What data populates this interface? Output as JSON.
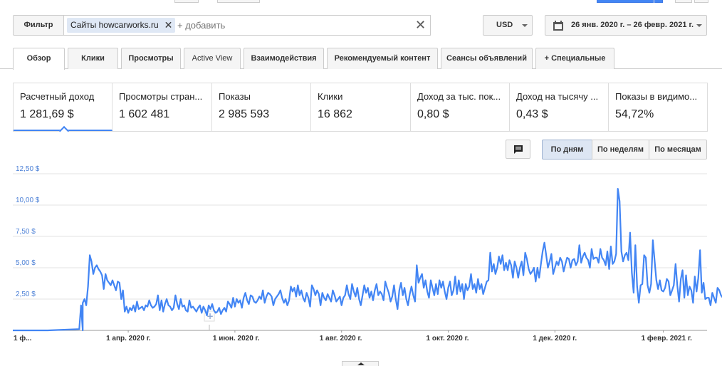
{
  "filter": {
    "label": "Фильтр",
    "chip": "Сайты howcarworks.ru",
    "add_placeholder": "+ добавить"
  },
  "currency": "USD",
  "date_range": "26 янв. 2020 г. – 26 февр. 2021 г.",
  "tabs": [
    {
      "label": "Обзор"
    },
    {
      "label": "Клики"
    },
    {
      "label": "Просмотры"
    },
    {
      "label": "Active View"
    },
    {
      "label": "Взаимодействия"
    },
    {
      "label": "Рекомендуемый контент"
    },
    {
      "label": "Сеансы объявлений"
    },
    {
      "label": "+  Специальные"
    }
  ],
  "metrics": [
    {
      "label": "Расчетный доход",
      "value": "1 281,69 $"
    },
    {
      "label": "Просмотры стран...",
      "value": "1 602 481"
    },
    {
      "label": "Показы",
      "value": "2 985 593"
    },
    {
      "label": "Клики",
      "value": "16 862"
    },
    {
      "label": "Доход за тыс. пок...",
      "value": "0,80 $"
    },
    {
      "label": "Доход на тысячу ...",
      "value": "0,43 $"
    },
    {
      "label": "Показы в видимо...",
      "value": "54,72%"
    }
  ],
  "granularity": [
    {
      "label": "По дням"
    },
    {
      "label": "По неделям"
    },
    {
      "label": "По месяцам"
    }
  ],
  "chart_data": {
    "type": "line",
    "series": [
      {
        "color": "#4285f4"
      }
    ],
    "y_ticks": [
      "12,50 $",
      "10,00 $",
      "7,50 $",
      "5,00 $",
      "2,50 $"
    ],
    "y_tick_values": [
      12.5,
      10,
      7.5,
      5,
      2.5
    ],
    "ylim": [
      0,
      12.5
    ],
    "x_ticks": [
      "1 ф...",
      "1 апр. 2020 г.",
      "1 июн. 2020 г.",
      "1 авг. 2020 г.",
      "1 окт. 2020 г.",
      "1 дек. 2020 г.",
      "1 февр. 2021 г."
    ],
    "x_tick_days": [
      6,
      66,
      127,
      188,
      249,
      310,
      372
    ],
    "x_range_days": [
      0,
      397
    ],
    "grid": true,
    "points": [
      [
        0,
        0
      ],
      [
        20,
        0
      ],
      [
        40,
        0
      ],
      [
        38,
        0.1
      ],
      [
        39,
        2.0
      ],
      [
        40,
        2.2
      ],
      [
        41,
        2.5
      ],
      [
        42,
        2.0
      ],
      [
        43,
        3.5
      ],
      [
        44,
        6.0
      ],
      [
        45,
        5.5
      ],
      [
        46,
        4.5
      ],
      [
        47,
        5.0
      ],
      [
        48,
        5.2
      ],
      [
        49,
        4.9
      ],
      [
        50,
        4.7
      ],
      [
        51,
        4.4
      ],
      [
        52,
        3.3
      ],
      [
        53,
        4.5
      ],
      [
        54,
        4.0
      ],
      [
        55,
        3.8
      ],
      [
        56,
        3.6
      ],
      [
        57,
        4.0
      ],
      [
        58,
        3.6
      ],
      [
        59,
        3.2
      ],
      [
        60,
        3.9
      ],
      [
        61,
        3.8
      ],
      [
        62,
        2.5
      ],
      [
        63,
        3.2
      ],
      [
        64,
        1.5
      ],
      [
        65,
        1.9
      ],
      [
        66,
        1.4
      ],
      [
        67,
        1.8
      ],
      [
        68,
        1.6
      ],
      [
        69,
        2.0
      ],
      [
        70,
        1.5
      ],
      [
        71,
        2.3
      ],
      [
        72,
        1.7
      ],
      [
        73,
        1.8
      ],
      [
        74,
        1.9
      ],
      [
        75,
        1.6
      ],
      [
        76,
        2.0
      ],
      [
        77,
        1.9
      ],
      [
        78,
        2.4
      ],
      [
        79,
        2.0
      ],
      [
        80,
        1.8
      ],
      [
        81,
        1.9
      ],
      [
        82,
        2.1
      ],
      [
        83,
        2.8
      ],
      [
        84,
        1.6
      ],
      [
        85,
        2.4
      ],
      [
        86,
        1.5
      ],
      [
        87,
        2.1
      ],
      [
        88,
        2.5
      ],
      [
        89,
        2.0
      ],
      [
        90,
        1.9
      ],
      [
        91,
        1.6
      ],
      [
        92,
        1.8
      ],
      [
        93,
        2.8
      ],
      [
        94,
        2.1
      ],
      [
        95,
        1.7
      ],
      [
        96,
        2.5
      ],
      [
        97,
        1.9
      ],
      [
        98,
        2.0
      ],
      [
        99,
        1.6
      ],
      [
        100,
        1.5
      ],
      [
        101,
        2.4
      ],
      [
        102,
        1.8
      ],
      [
        103,
        1.9
      ],
      [
        104,
        1.7
      ],
      [
        105,
        1.5
      ],
      [
        106,
        1.8
      ],
      [
        107,
        2.0
      ],
      [
        108,
        1.4
      ],
      [
        109,
        1.9
      ],
      [
        110,
        1.6
      ],
      [
        111,
        1.2
      ],
      [
        112,
        2.0
      ],
      [
        113,
        1.7
      ],
      [
        114,
        2.1
      ],
      [
        115,
        1.6
      ],
      [
        116,
        1.4
      ],
      [
        117,
        1.5
      ],
      [
        118,
        1.8
      ],
      [
        119,
        1.3
      ],
      [
        120,
        1.6
      ],
      [
        121,
        1.8
      ],
      [
        122,
        1.5
      ],
      [
        123,
        2.3
      ],
      [
        124,
        2.1
      ],
      [
        125,
        1.8
      ],
      [
        126,
        2.6
      ],
      [
        127,
        1.9
      ],
      [
        128,
        2.5
      ],
      [
        129,
        2.2
      ],
      [
        130,
        2.4
      ],
      [
        131,
        1.8
      ],
      [
        132,
        2.6
      ],
      [
        133,
        3.0
      ],
      [
        134,
        2.4
      ],
      [
        135,
        2.1
      ],
      [
        136,
        2.8
      ],
      [
        137,
        2.7
      ],
      [
        138,
        2.3
      ],
      [
        139,
        2.2
      ],
      [
        140,
        2.4
      ],
      [
        141,
        2.7
      ],
      [
        142,
        2.5
      ],
      [
        143,
        3.2
      ],
      [
        144,
        2.2
      ],
      [
        145,
        2.7
      ],
      [
        146,
        3.0
      ],
      [
        147,
        2.9
      ],
      [
        148,
        2.7
      ],
      [
        149,
        2.0
      ],
      [
        150,
        2.5
      ],
      [
        151,
        2.7
      ],
      [
        152,
        2.9
      ],
      [
        153,
        3.2
      ],
      [
        154,
        2.6
      ],
      [
        155,
        2.2
      ],
      [
        156,
        2.5
      ],
      [
        157,
        2.0
      ],
      [
        158,
        2.4
      ],
      [
        159,
        3.5
      ],
      [
        160,
        3.1
      ],
      [
        161,
        3.4
      ],
      [
        162,
        2.7
      ],
      [
        163,
        3.6
      ],
      [
        164,
        2.8
      ],
      [
        165,
        3.2
      ],
      [
        166,
        2.6
      ],
      [
        167,
        2.3
      ],
      [
        168,
        3.0
      ],
      [
        169,
        2.6
      ],
      [
        170,
        1.9
      ],
      [
        171,
        3.6
      ],
      [
        172,
        3.3
      ],
      [
        173,
        2.8
      ],
      [
        174,
        3.2
      ],
      [
        175,
        2.9
      ],
      [
        176,
        2.0
      ],
      [
        177,
        3.0
      ],
      [
        178,
        2.6
      ],
      [
        179,
        2.4
      ],
      [
        180,
        2.9
      ],
      [
        181,
        2.6
      ],
      [
        182,
        2.3
      ],
      [
        183,
        3.2
      ],
      [
        184,
        2.8
      ],
      [
        185,
        2.3
      ],
      [
        186,
        2.5
      ],
      [
        187,
        2.7
      ],
      [
        188,
        2.0
      ],
      [
        189,
        2.6
      ],
      [
        190,
        2.8
      ],
      [
        191,
        3.6
      ],
      [
        192,
        2.9
      ],
      [
        193,
        2.5
      ],
      [
        194,
        3.7
      ],
      [
        195,
        3.1
      ],
      [
        196,
        2.7
      ],
      [
        197,
        3.4
      ],
      [
        198,
        2.5
      ],
      [
        199,
        2.0
      ],
      [
        200,
        2.8
      ],
      [
        201,
        3.6
      ],
      [
        202,
        3.0
      ],
      [
        203,
        3.4
      ],
      [
        204,
        2.6
      ],
      [
        205,
        3.1
      ],
      [
        206,
        2.4
      ],
      [
        207,
        3.2
      ],
      [
        208,
        3.7
      ],
      [
        209,
        2.8
      ],
      [
        210,
        3.1
      ],
      [
        211,
        2.9
      ],
      [
        212,
        2.4
      ],
      [
        213,
        3.9
      ],
      [
        214,
        3.4
      ],
      [
        215,
        3.0
      ],
      [
        216,
        2.3
      ],
      [
        217,
        2.7
      ],
      [
        218,
        3.6
      ],
      [
        219,
        2.5
      ],
      [
        220,
        1.7
      ],
      [
        221,
        3.2
      ],
      [
        222,
        3.8
      ],
      [
        223,
        2.8
      ],
      [
        224,
        3.4
      ],
      [
        225,
        2.5
      ],
      [
        226,
        2.0
      ],
      [
        227,
        2.9
      ],
      [
        228,
        3.5
      ],
      [
        229,
        2.8
      ],
      [
        230,
        2.3
      ],
      [
        231,
        5.2
      ],
      [
        232,
        3.8
      ],
      [
        233,
        4.2
      ],
      [
        234,
        4.5
      ],
      [
        235,
        3.4
      ],
      [
        236,
        4.0
      ],
      [
        237,
        3.1
      ],
      [
        238,
        2.6
      ],
      [
        239,
        4.0
      ],
      [
        240,
        3.4
      ],
      [
        241,
        2.8
      ],
      [
        242,
        3.7
      ],
      [
        243,
        2.9
      ],
      [
        244,
        4.0
      ],
      [
        245,
        3.4
      ],
      [
        246,
        3.9
      ],
      [
        247,
        3.1
      ],
      [
        248,
        2.5
      ],
      [
        249,
        3.4
      ],
      [
        250,
        3.9
      ],
      [
        251,
        2.8
      ],
      [
        252,
        3.2
      ],
      [
        253,
        4.3
      ],
      [
        254,
        2.9
      ],
      [
        255,
        4.0
      ],
      [
        256,
        3.1
      ],
      [
        257,
        3.7
      ],
      [
        258,
        2.5
      ],
      [
        259,
        3.7
      ],
      [
        260,
        3.2
      ],
      [
        261,
        3.5
      ],
      [
        262,
        4.5
      ],
      [
        263,
        3.3
      ],
      [
        264,
        3.7
      ],
      [
        265,
        3.0
      ],
      [
        266,
        4.1
      ],
      [
        267,
        3.3
      ],
      [
        268,
        3.7
      ],
      [
        269,
        2.9
      ],
      [
        270,
        3.4
      ],
      [
        271,
        3.9
      ],
      [
        272,
        4.0
      ],
      [
        273,
        6.2
      ],
      [
        274,
        4.7
      ],
      [
        275,
        5.3
      ],
      [
        276,
        4.5
      ],
      [
        277,
        5.0
      ],
      [
        278,
        5.9
      ],
      [
        279,
        5.3
      ],
      [
        280,
        6.0
      ],
      [
        281,
        4.8
      ],
      [
        282,
        5.4
      ],
      [
        283,
        4.8
      ],
      [
        284,
        5.6
      ],
      [
        285,
        5.2
      ],
      [
        286,
        4.2
      ],
      [
        287,
        5.5
      ],
      [
        288,
        5.0
      ],
      [
        289,
        4.2
      ],
      [
        290,
        5.0
      ],
      [
        291,
        5.5
      ],
      [
        292,
        4.4
      ],
      [
        293,
        6.2
      ],
      [
        294,
        5.7
      ],
      [
        295,
        4.9
      ],
      [
        296,
        4.5
      ],
      [
        297,
        4.7
      ],
      [
        298,
        5.0
      ],
      [
        299,
        3.9
      ],
      [
        300,
        5.0
      ],
      [
        301,
        4.2
      ],
      [
        302,
        5.3
      ],
      [
        303,
        6.3
      ],
      [
        304,
        7.0
      ],
      [
        305,
        6.0
      ],
      [
        306,
        5.0
      ],
      [
        307,
        5.5
      ],
      [
        308,
        6.1
      ],
      [
        309,
        4.5
      ],
      [
        310,
        5.0
      ],
      [
        311,
        5.5
      ],
      [
        312,
        5.2
      ],
      [
        313,
        5.8
      ],
      [
        314,
        5.5
      ],
      [
        315,
        4.7
      ],
      [
        316,
        5.3
      ],
      [
        317,
        5.8
      ],
      [
        318,
        5.7
      ],
      [
        319,
        5.0
      ],
      [
        320,
        5.6
      ],
      [
        321,
        5.7
      ],
      [
        322,
        5.2
      ],
      [
        323,
        5.5
      ],
      [
        324,
        6.8
      ],
      [
        325,
        5.4
      ],
      [
        326,
        5.9
      ],
      [
        327,
        6.2
      ],
      [
        328,
        5.8
      ],
      [
        329,
        5.6
      ],
      [
        330,
        5.0
      ],
      [
        331,
        6.5
      ],
      [
        332,
        5.7
      ],
      [
        333,
        5.8
      ],
      [
        334,
        5.8
      ],
      [
        335,
        5.4
      ],
      [
        336,
        6.5
      ],
      [
        337,
        5.8
      ],
      [
        338,
        5.6
      ],
      [
        339,
        5.2
      ],
      [
        340,
        6.3
      ],
      [
        341,
        4.9
      ],
      [
        342,
        6.7
      ],
      [
        343,
        5.3
      ],
      [
        344,
        5.5
      ],
      [
        345,
        6.1
      ],
      [
        346,
        11.3
      ],
      [
        347,
        10.3
      ],
      [
        348,
        6.3
      ],
      [
        349,
        5.5
      ],
      [
        350,
        6.0
      ],
      [
        351,
        6.2
      ],
      [
        352,
        5.6
      ],
      [
        353,
        7.8
      ],
      [
        354,
        4.6
      ],
      [
        355,
        3.0
      ],
      [
        356,
        6.8
      ],
      [
        357,
        3.5
      ],
      [
        358,
        2.2
      ],
      [
        359,
        3.6
      ],
      [
        360,
        3.7
      ],
      [
        361,
        6.0
      ],
      [
        362,
        5.8
      ],
      [
        363,
        3.6
      ],
      [
        364,
        3.0
      ],
      [
        365,
        3.7
      ],
      [
        366,
        7.2
      ],
      [
        367,
        5.6
      ],
      [
        368,
        4.0
      ],
      [
        369,
        3.3
      ],
      [
        370,
        4.0
      ],
      [
        371,
        3.2
      ],
      [
        372,
        3.1
      ],
      [
        373,
        3.4
      ],
      [
        374,
        4.1
      ],
      [
        375,
        3.9
      ],
      [
        376,
        2.8
      ],
      [
        377,
        3.2
      ],
      [
        378,
        3.6
      ],
      [
        379,
        5.3
      ],
      [
        380,
        3.6
      ],
      [
        381,
        2.3
      ],
      [
        382,
        4.1
      ],
      [
        383,
        4.8
      ],
      [
        384,
        2.6
      ],
      [
        385,
        4.4
      ],
      [
        386,
        2.8
      ],
      [
        387,
        3.5
      ],
      [
        388,
        3.2
      ],
      [
        389,
        2.2
      ],
      [
        390,
        4.3
      ],
      [
        391,
        3.1
      ],
      [
        392,
        4.2
      ],
      [
        393,
        6.4
      ],
      [
        394,
        3.0
      ],
      [
        395,
        3.8
      ],
      [
        396,
        2.5
      ],
      [
        397,
        2.6
      ],
      [
        398,
        2.6
      ],
      [
        399,
        2.0
      ],
      [
        400,
        3.0
      ],
      [
        401,
        2.6
      ],
      [
        402,
        2.2
      ],
      [
        403,
        3.4
      ],
      [
        404,
        3.2
      ],
      [
        405,
        2.8
      ],
      [
        406,
        2.6
      ],
      [
        407,
        6.6
      ],
      [
        408,
        2.4
      ],
      [
        409,
        2.5
      ],
      [
        410,
        2.8
      ],
      [
        411,
        2.8
      ],
      [
        412,
        2.3
      ],
      [
        413,
        3.8
      ],
      [
        414,
        4.0
      ]
    ]
  }
}
